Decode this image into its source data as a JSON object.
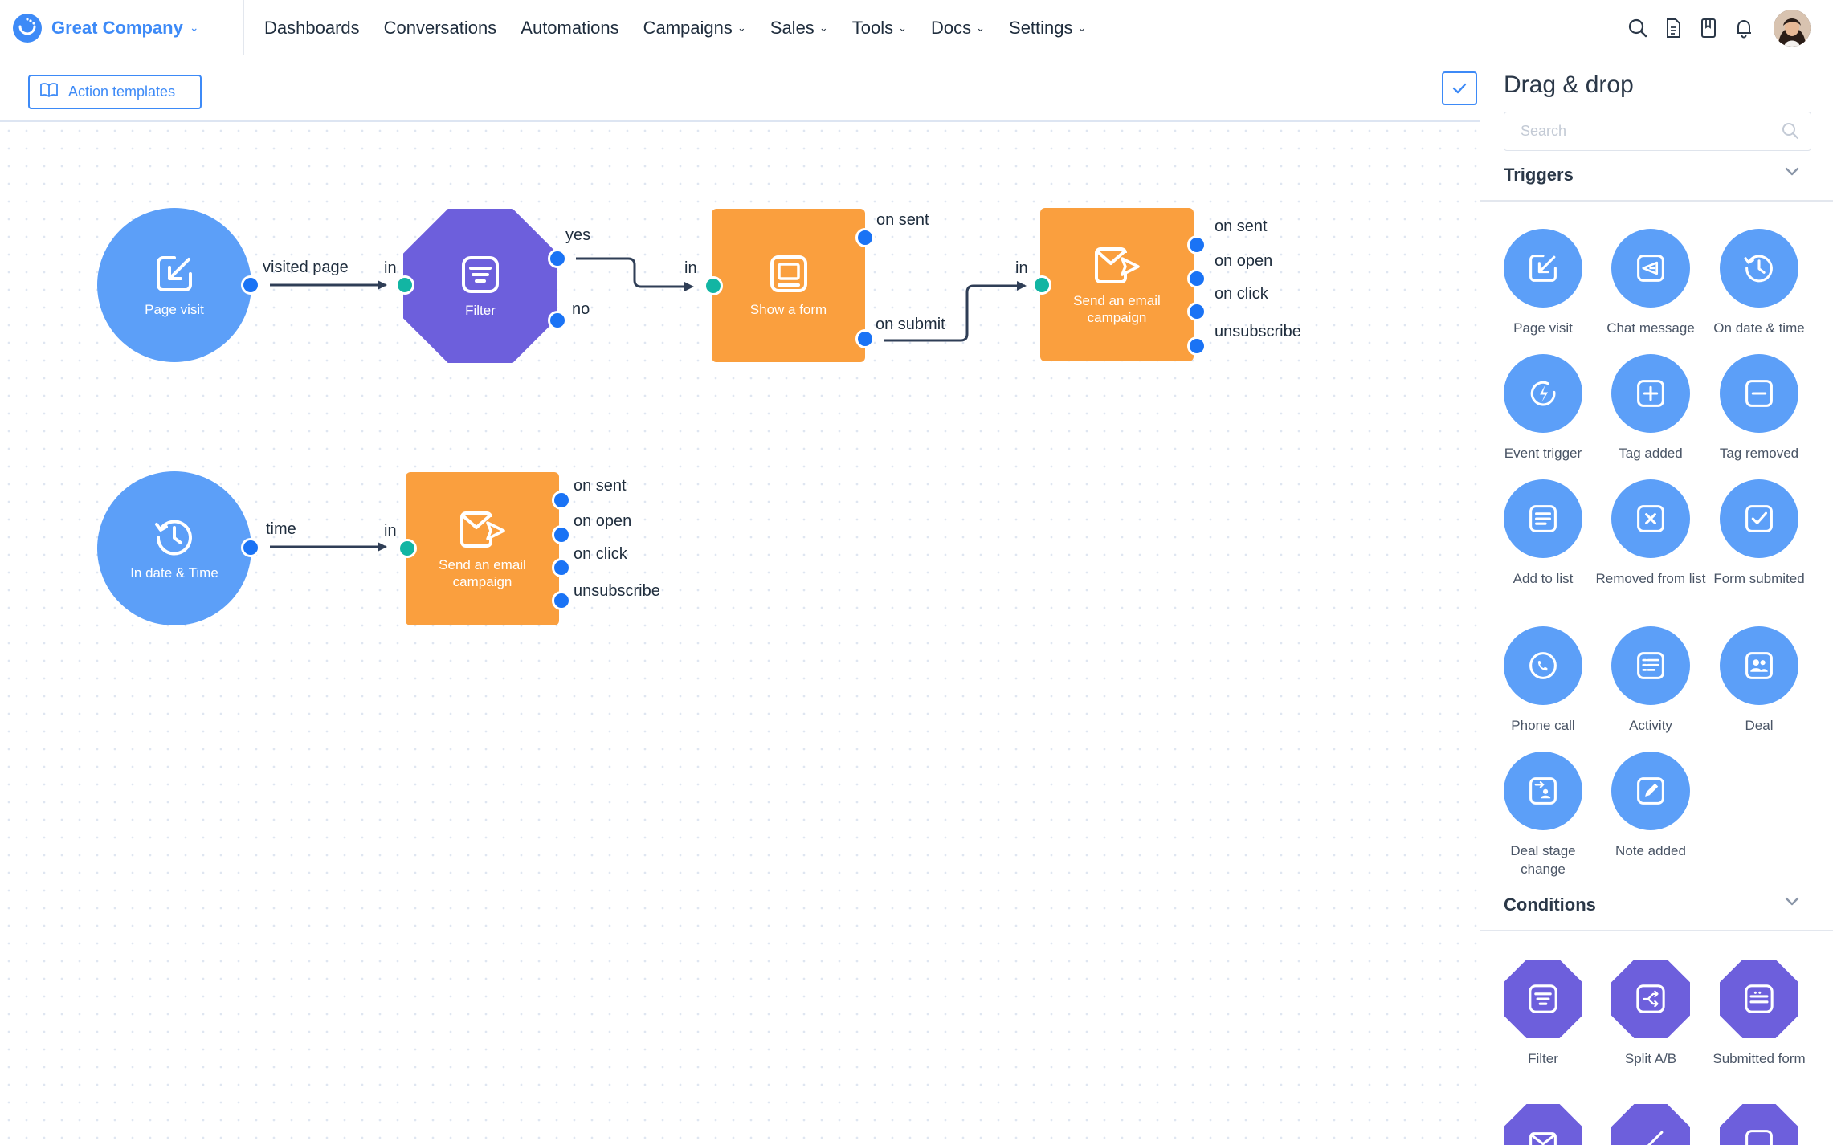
{
  "brand": {
    "name": "Great Company"
  },
  "nav": [
    {
      "label": "Dashboards",
      "dropdown": false
    },
    {
      "label": "Conversations",
      "dropdown": false
    },
    {
      "label": "Automations",
      "dropdown": false
    },
    {
      "label": "Campaigns",
      "dropdown": true
    },
    {
      "label": "Sales",
      "dropdown": true
    },
    {
      "label": "Tools",
      "dropdown": true
    },
    {
      "label": "Docs",
      "dropdown": true
    },
    {
      "label": "Settings",
      "dropdown": true
    }
  ],
  "top_icons": [
    "search-icon",
    "document-icon",
    "book-icon",
    "bell-icon"
  ],
  "toolbar": {
    "templates_label": "Action templates"
  },
  "canvas": {
    "flow1": {
      "page_visit": "Page visit",
      "visited_page": "visited page",
      "in": "in",
      "filter": "Filter",
      "yes": "yes",
      "no": "no",
      "show_form": "Show a form",
      "on_sent": "on sent",
      "on_submit": "on submit",
      "email": "Send an email campaign",
      "outputs": [
        "on sent",
        "on open",
        "on click",
        "unsubscribe"
      ]
    },
    "flow2": {
      "date_time": "In date & Time",
      "time": "time",
      "in": "in",
      "email": "Send an email campaign",
      "outputs": [
        "on sent",
        "on open",
        "on click",
        "unsubscribe"
      ]
    }
  },
  "panel": {
    "title": "Drag & drop",
    "search_placeholder": "Search",
    "triggers_title": "Triggers",
    "triggers": [
      {
        "label": "Page visit",
        "icon": "page-visit-icon"
      },
      {
        "label": "Chat message",
        "icon": "chat-message-icon"
      },
      {
        "label": "On date & time",
        "icon": "clock-icon"
      },
      {
        "label": "Event trigger",
        "icon": "event-trigger-icon"
      },
      {
        "label": "Tag added",
        "icon": "tag-added-icon"
      },
      {
        "label": "Tag removed",
        "icon": "tag-removed-icon"
      },
      {
        "label": "Add to list",
        "icon": "add-to-list-icon"
      },
      {
        "label": "Removed from list",
        "icon": "removed-from-list-icon"
      },
      {
        "label": "Form submited",
        "icon": "form-submitted-icon"
      },
      {
        "label": "Phone call",
        "icon": "phone-call-icon"
      },
      {
        "label": "Activity",
        "icon": "activity-icon"
      },
      {
        "label": "Deal",
        "icon": "deal-icon"
      },
      {
        "label": "Deal stage change",
        "icon": "deal-stage-icon"
      },
      {
        "label": "Note added",
        "icon": "note-added-icon"
      }
    ],
    "conditions_title": "Conditions",
    "conditions": [
      {
        "label": "Filter",
        "icon": "filter-icon"
      },
      {
        "label": "Split A/B",
        "icon": "split-icon"
      },
      {
        "label": "Submitted form",
        "icon": "submitted-form-icon"
      }
    ]
  }
}
